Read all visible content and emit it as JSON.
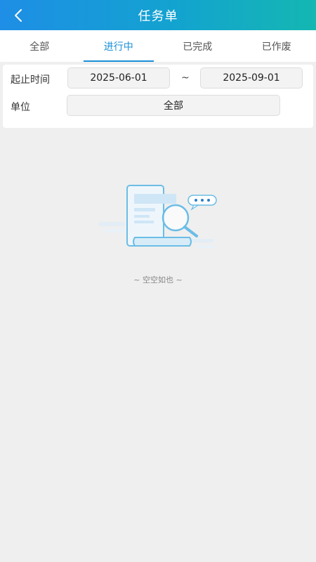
{
  "header": {
    "title": "任务单",
    "back_icon": "chevron-left-icon"
  },
  "tabs": [
    {
      "label": "全部",
      "active": false
    },
    {
      "label": "进行中",
      "active": true
    },
    {
      "label": "已完成",
      "active": false
    },
    {
      "label": "已作废",
      "active": false
    }
  ],
  "filters": {
    "date_label": "起止时间",
    "start_date": "2025-06-01",
    "separator": "~",
    "end_date": "2025-09-01",
    "unit_label": "单位",
    "unit_value": "全部"
  },
  "empty_state": {
    "icon": "document-search-icon",
    "text": "~ 空空如也 ~"
  },
  "colors": {
    "accent": "#1a8fd8",
    "header_gradient_start": "#1e8ee6",
    "header_gradient_end": "#14b7b2",
    "background": "#efefef"
  }
}
